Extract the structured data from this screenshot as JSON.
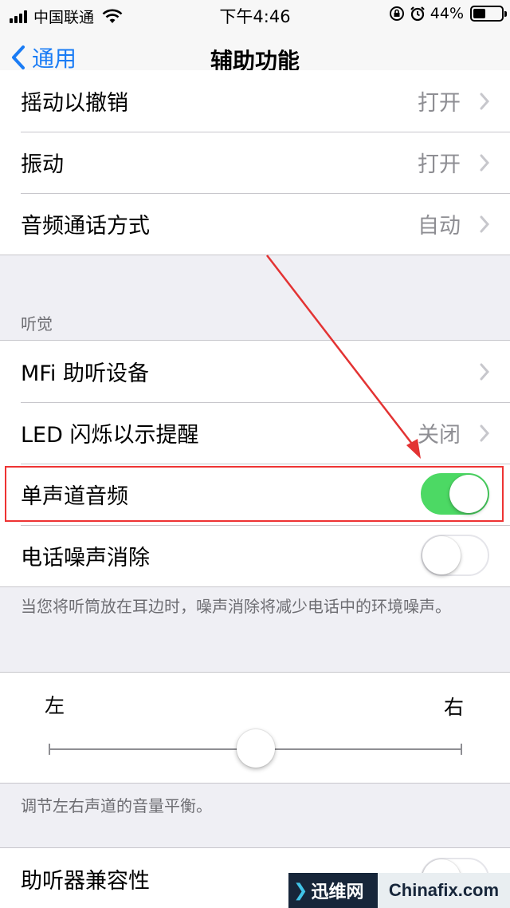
{
  "status_bar": {
    "carrier": "中国联通",
    "time": "下午4:46",
    "battery_percent": "44%",
    "battery_level": 0.44
  },
  "nav": {
    "back_label": "通用",
    "title": "辅助功能"
  },
  "rows_top": [
    {
      "label": "摇动以撤销",
      "value": "打开"
    },
    {
      "label": "振动",
      "value": "打开"
    },
    {
      "label": "音频通话方式",
      "value": "自动"
    }
  ],
  "hearing": {
    "header": "听觉",
    "rows": [
      {
        "label": "MFi 助听设备",
        "value": ""
      },
      {
        "label": "LED 闪烁以示提醒",
        "value": "关闭"
      },
      {
        "label": "单声道音频",
        "toggle_on": true
      },
      {
        "label": "电话噪声消除",
        "toggle_on": false
      }
    ],
    "footer": "当您将听筒放在耳边时，噪声消除将减少电话中的环境噪声。"
  },
  "balance": {
    "left_label": "左",
    "right_label": "右",
    "position": 0.5,
    "footer": "调节左右声道的音量平衡。"
  },
  "rows_bottom": [
    {
      "label": "助听器兼容性",
      "toggle_on": false
    }
  ],
  "watermark": {
    "left_text": "迅维网",
    "right_text": "Chinafix.com"
  },
  "colors": {
    "accent": "#1a7cf5",
    "toggle_on": "#4cd964",
    "highlight": "#e33333"
  }
}
